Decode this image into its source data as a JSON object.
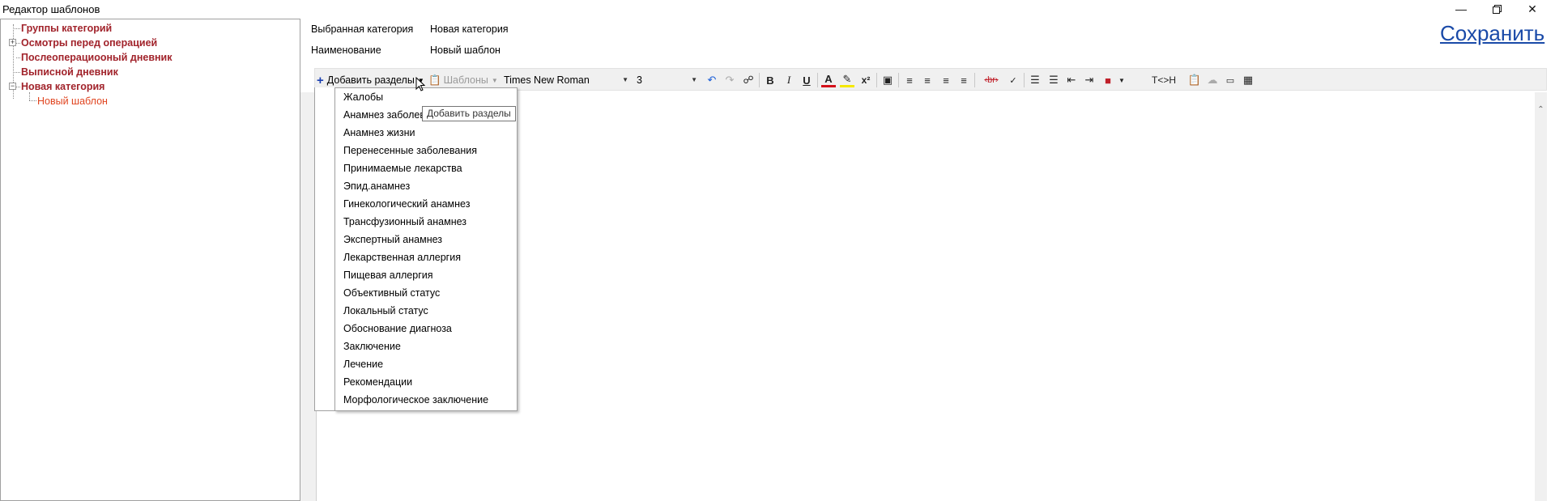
{
  "window": {
    "title": "Редактор шаблонов",
    "minimize_icon": "minimize-icon",
    "restore_icon": "restore-icon",
    "close_icon": "close-icon"
  },
  "tree": {
    "items": [
      {
        "label": "Группы категорий",
        "type": "category"
      },
      {
        "label": "Осмотры перед операцией",
        "type": "category",
        "expander": "+"
      },
      {
        "label": "Послеоперациооный дневник",
        "type": "category"
      },
      {
        "label": "Выписной дневник",
        "type": "category"
      },
      {
        "label": "Новая категория",
        "type": "category",
        "expander": "−"
      },
      {
        "label": "Новый шаблон",
        "type": "template"
      }
    ]
  },
  "info": {
    "selected_category_label": "Выбранная категория",
    "selected_category_value": "Новая категория",
    "name_label": "Наименование",
    "name_value": "Новый шаблон"
  },
  "save_label": "Сохранить",
  "toolbar": {
    "add_sections_label": "Добавить разделы",
    "templates_label": "Шаблоны",
    "font_name": "Times New Roman",
    "font_size": "3",
    "case_toggle_label": "T<>H",
    "strike_label": "‹br›"
  },
  "tooltip": "Добавить разделы",
  "dropdown": {
    "items": [
      "Жалобы",
      "Анамнез заболев",
      "Анамнез жизни",
      "Перенесенные заболевания",
      "Принимаемые лекарства",
      "Эпид.анамнез",
      "Гинекологический анамнез",
      "Трансфузионный анамнез",
      "Экспертный анамнез",
      "Лекарственная аллергия",
      "Пищевая аллергия",
      "Объективный статус",
      "Локальный статус",
      "Обоснование диагноза",
      "Заключение",
      "Лечение",
      "Рекомендации",
      "Морфологическое заключение"
    ]
  },
  "colors": {
    "category_text": "#a1232b",
    "template_text": "#e0441f",
    "save_link": "#1a4aa8"
  }
}
